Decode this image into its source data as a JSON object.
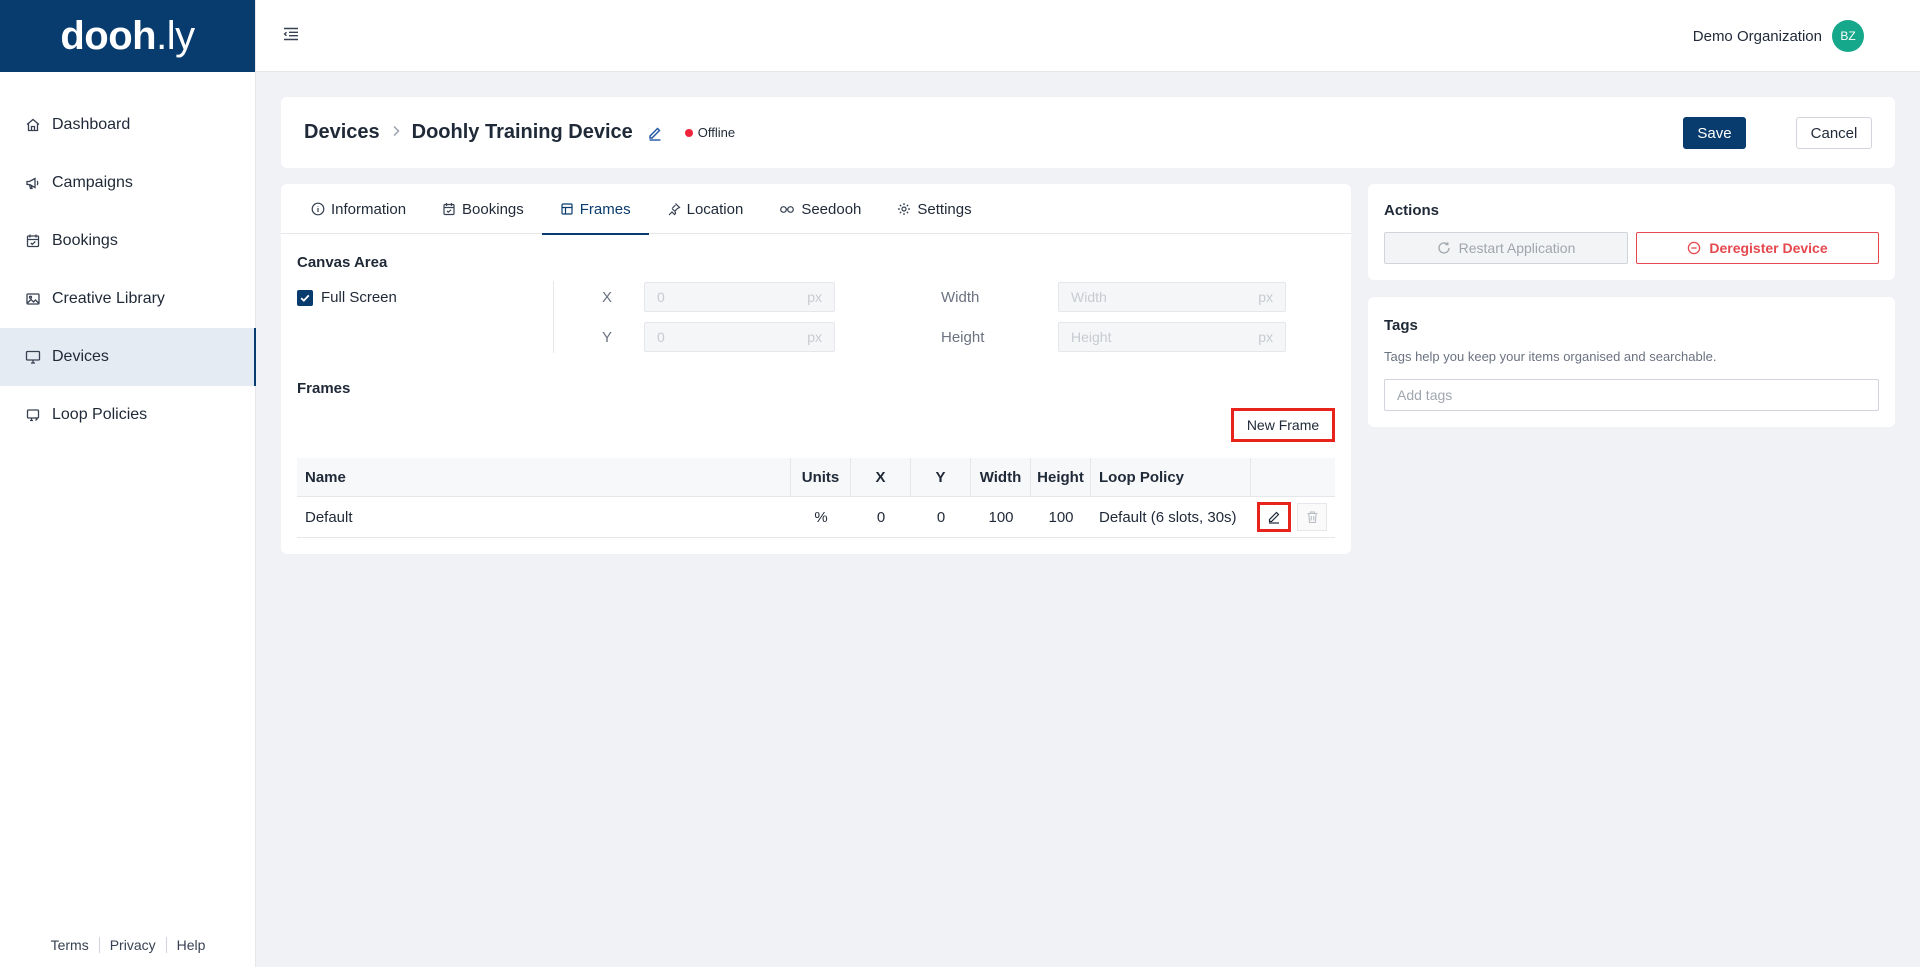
{
  "brand": {
    "logo_main": "dooh",
    "logo_dot": ".",
    "logo_tail": "ly",
    "color": "#083b6e"
  },
  "sidebar": {
    "items": [
      {
        "label": "Dashboard",
        "icon": "home-icon"
      },
      {
        "label": "Campaigns",
        "icon": "megaphone-icon"
      },
      {
        "label": "Bookings",
        "icon": "calendar-check-icon"
      },
      {
        "label": "Creative Library",
        "icon": "image-icon"
      },
      {
        "label": "Devices",
        "icon": "monitor-icon",
        "active": true
      },
      {
        "label": "Loop Policies",
        "icon": "loop-icon"
      }
    ],
    "footer": {
      "terms": "Terms",
      "privacy": "Privacy",
      "help": "Help"
    }
  },
  "topbar": {
    "org_name": "Demo Organization",
    "avatar_initials": "BZ",
    "avatar_color": "#16a88a"
  },
  "header": {
    "breadcrumb_root": "Devices",
    "device_name": "Doohly Training Device",
    "status": "Offline",
    "status_color": "#ef233c",
    "save_label": "Save",
    "cancel_label": "Cancel"
  },
  "tabs": [
    {
      "label": "Information",
      "icon": "info-icon"
    },
    {
      "label": "Bookings",
      "icon": "calendar-check-icon"
    },
    {
      "label": "Frames",
      "icon": "frame-icon",
      "active": true
    },
    {
      "label": "Location",
      "icon": "pin-icon"
    },
    {
      "label": "Seedooh",
      "icon": "glasses-icon"
    },
    {
      "label": "Settings",
      "icon": "gear-icon"
    }
  ],
  "canvas": {
    "title": "Canvas Area",
    "full_screen_label": "Full Screen",
    "full_screen_checked": true,
    "x_label": "X",
    "y_label": "Y",
    "width_label": "Width",
    "height_label": "Height",
    "x_placeholder": "0",
    "y_placeholder": "0",
    "width_placeholder": "Width",
    "height_placeholder": "Height",
    "unit": "px"
  },
  "frames": {
    "title": "Frames",
    "new_frame_label": "New Frame",
    "columns": [
      "Name",
      "Units",
      "X",
      "Y",
      "Width",
      "Height",
      "Loop Policy",
      ""
    ],
    "rows": [
      {
        "name": "Default",
        "units": "%",
        "x": "0",
        "y": "0",
        "width": "100",
        "height": "100",
        "loop_policy": "Default (6 slots, 30s)"
      }
    ]
  },
  "actions": {
    "title": "Actions",
    "restart_label": "Restart Application",
    "deregister_label": "Deregister Device"
  },
  "tags": {
    "title": "Tags",
    "help_text": "Tags help you keep your items organised and searchable.",
    "placeholder": "Add tags"
  }
}
